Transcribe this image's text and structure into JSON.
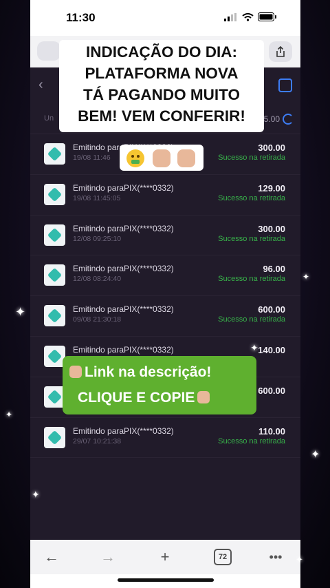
{
  "status_bar": {
    "time": "11:30"
  },
  "browser": {
    "open_tabs": "72"
  },
  "app": {
    "summary_value": "5.00",
    "transactions": [
      {
        "title": "Emitindo paraPIX(****0332)",
        "date": "19/08 11:46",
        "amount": "300.00",
        "status": "Sucesso na retirada"
      },
      {
        "title": "Emitindo paraPIX(****0332)",
        "date": "19/08 11:45:05",
        "amount": "129.00",
        "status": "Sucesso na retirada"
      },
      {
        "title": "Emitindo paraPIX(****0332)",
        "date": "12/08 09:25:10",
        "amount": "300.00",
        "status": "Sucesso na retirada"
      },
      {
        "title": "Emitindo paraPIX(****0332)",
        "date": "12/08 08:24:40",
        "amount": "96.00",
        "status": "Sucesso na retirada"
      },
      {
        "title": "Emitindo paraPIX(****0332)",
        "date": "09/08 21:30:18",
        "amount": "600.00",
        "status": "Sucesso na retirada"
      },
      {
        "title": "Emitindo paraPIX(****0332)",
        "date": "",
        "amount": "140.00",
        "status": ""
      },
      {
        "title": "",
        "date": "",
        "amount": "600.00",
        "status": ""
      },
      {
        "title": "Emitindo paraPIX(****0332)",
        "date": "29/07 10:21:38",
        "amount": "110.00",
        "status": "Sucesso na retirada"
      }
    ]
  },
  "overlay": {
    "caption_lines": [
      "INDICAÇÃO DO DIA:",
      "PLATAFORMA NOVA",
      "TÁ PAGANDO MUITO",
      "BEM! VEM CONFERIR!"
    ],
    "emojis": [
      "money-mouth-face-emoji",
      "pointing-down-emoji",
      "pointing-down-emoji"
    ],
    "cta_line1": "Link na descrição!",
    "cta_line2": "CLIQUE E COPIE"
  },
  "colors": {
    "status_success": "#38b34a",
    "cta_bg": "#5fb02f",
    "pix_teal": "#32bcad",
    "accent_blue": "#3d7df5"
  }
}
